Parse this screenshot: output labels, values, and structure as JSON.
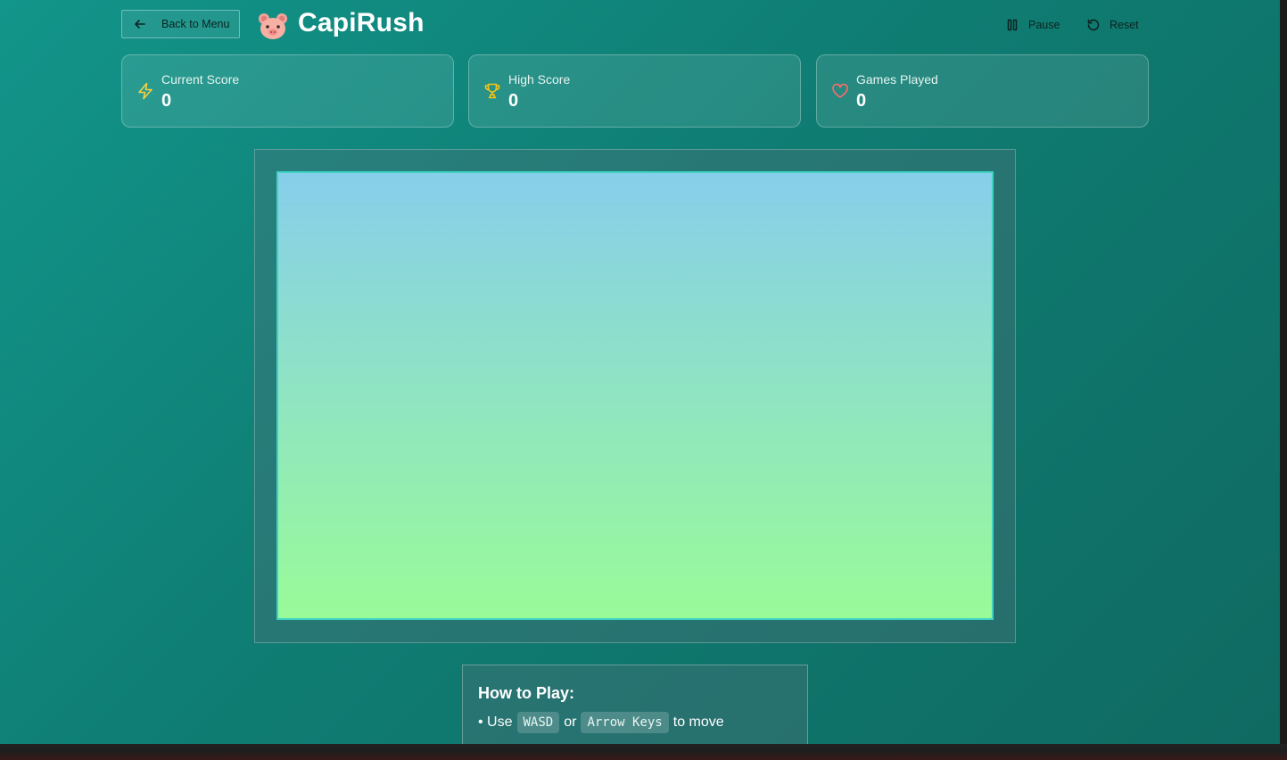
{
  "header": {
    "back_label": "Back to Menu",
    "app_title": "CapiRush",
    "pause_label": "Pause",
    "reset_label": "Reset"
  },
  "stats": [
    {
      "label": "Current Score",
      "value": "0",
      "icon": "lightning-icon",
      "color": "#f5d142"
    },
    {
      "label": "High Score",
      "value": "0",
      "icon": "trophy-icon",
      "color": "#f5c518"
    },
    {
      "label": "Games Played",
      "value": "0",
      "icon": "heart-icon",
      "color": "#ff6b6b"
    }
  ],
  "board": {
    "sky_color": "#87ceeb",
    "ground_color": "#98fb98",
    "border_color": "#3fd3c4"
  },
  "howto": {
    "title": "How to Play:",
    "line1_prefix": "• Use",
    "key1": "WASD",
    "line1_or": "or",
    "key2": "Arrow Keys",
    "line1_suffix": "to move"
  }
}
